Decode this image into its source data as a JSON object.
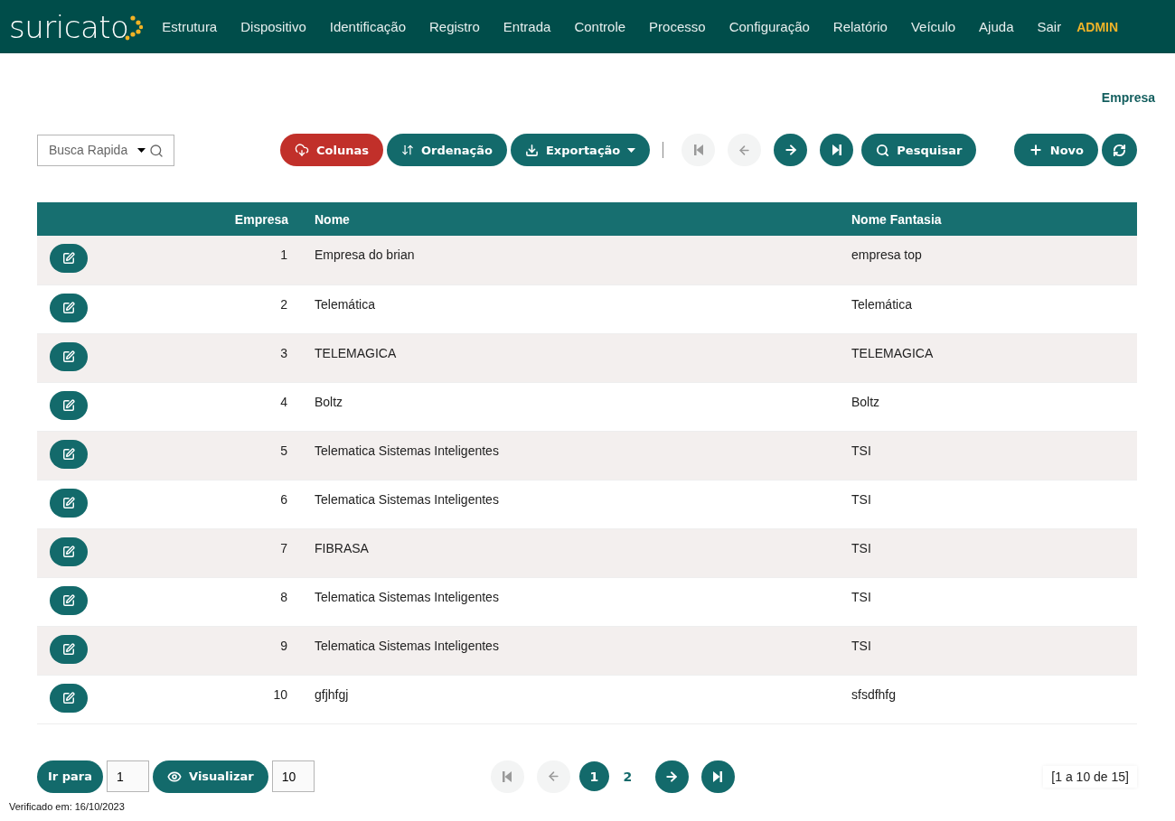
{
  "brand": {
    "name": "suricato"
  },
  "menu": [
    {
      "label": "Estrutura"
    },
    {
      "label": "Dispositivo"
    },
    {
      "label": "Identificação"
    },
    {
      "label": "Registro"
    },
    {
      "label": "Entrada"
    },
    {
      "label": "Controle"
    },
    {
      "label": "Processo"
    },
    {
      "label": "Configuração"
    },
    {
      "label": "Relatório"
    },
    {
      "label": "Veículo"
    },
    {
      "label": "Ajuda"
    },
    {
      "label": "Sair"
    }
  ],
  "user": "ADMIN",
  "page_title": "Empresa",
  "toolbar": {
    "search": {
      "placeholder": "Busca Rapida"
    },
    "columns_button": {
      "label": "Colunas"
    },
    "sort_button": {
      "label": "Ordenação"
    },
    "export_button": {
      "label": "Exportação"
    },
    "first_button": {
      "disabled": true
    },
    "prev_button": {
      "disabled": true
    },
    "next_button": {
      "disabled": false
    },
    "last_button": {
      "disabled": false
    },
    "search_button": {
      "label": "Pesquisar"
    },
    "new_button": {
      "label": "Novo"
    }
  },
  "table": {
    "columns": [
      "Empresa",
      "Nome",
      "Nome Fantasia"
    ],
    "rows": [
      [
        "1",
        "Empresa do brian",
        "empresa top"
      ],
      [
        "2",
        "Telemática",
        "Telemática"
      ],
      [
        "3",
        "TELEMAGICA",
        "TELEMAGICA"
      ],
      [
        "4",
        "Boltz",
        "Boltz"
      ],
      [
        "5",
        "Telematica Sistemas Inteligentes",
        "TSI"
      ],
      [
        "6",
        "Telematica Sistemas Inteligentes",
        "TSI"
      ],
      [
        "7",
        "FIBRASA",
        "TSI"
      ],
      [
        "8",
        "Telematica Sistemas Inteligentes",
        "TSI"
      ],
      [
        "9",
        "Telematica Sistemas Inteligentes",
        "TSI"
      ],
      [
        "10",
        "gfjhfgj",
        "sfsdfhfg"
      ]
    ]
  },
  "footer": {
    "goto": {
      "label": "Ir para",
      "value": "1"
    },
    "view": {
      "label": "Visualizar",
      "value": "10"
    },
    "first_button": {
      "disabled": true
    },
    "prev_button": {
      "disabled": true
    },
    "pages": [
      {
        "label": "1",
        "selected": true
      },
      {
        "label": "2",
        "selected": false
      }
    ],
    "next_button": {
      "disabled": false
    },
    "last_button": {
      "disabled": false
    },
    "summary": "[1 a 10 de 15]",
    "verified": "Verificado em: 16/10/2023"
  }
}
